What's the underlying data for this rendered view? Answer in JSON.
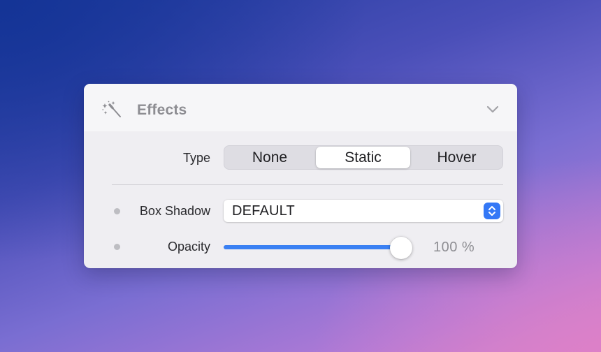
{
  "panel": {
    "title": "Effects",
    "icon": "magic-wand-icon",
    "collapse_icon": "chevron-down-icon"
  },
  "type": {
    "label": "Type",
    "options": [
      "None",
      "Static",
      "Hover"
    ],
    "selected": "Static"
  },
  "box_shadow": {
    "label": "Box Shadow",
    "value": "DEFAULT",
    "icon": "stepper-icon"
  },
  "opacity": {
    "label": "Opacity",
    "value": 1.0,
    "value_text": "100 %"
  },
  "colors": {
    "accent": "#3478f6",
    "slider_fill": "#3a80f3"
  }
}
